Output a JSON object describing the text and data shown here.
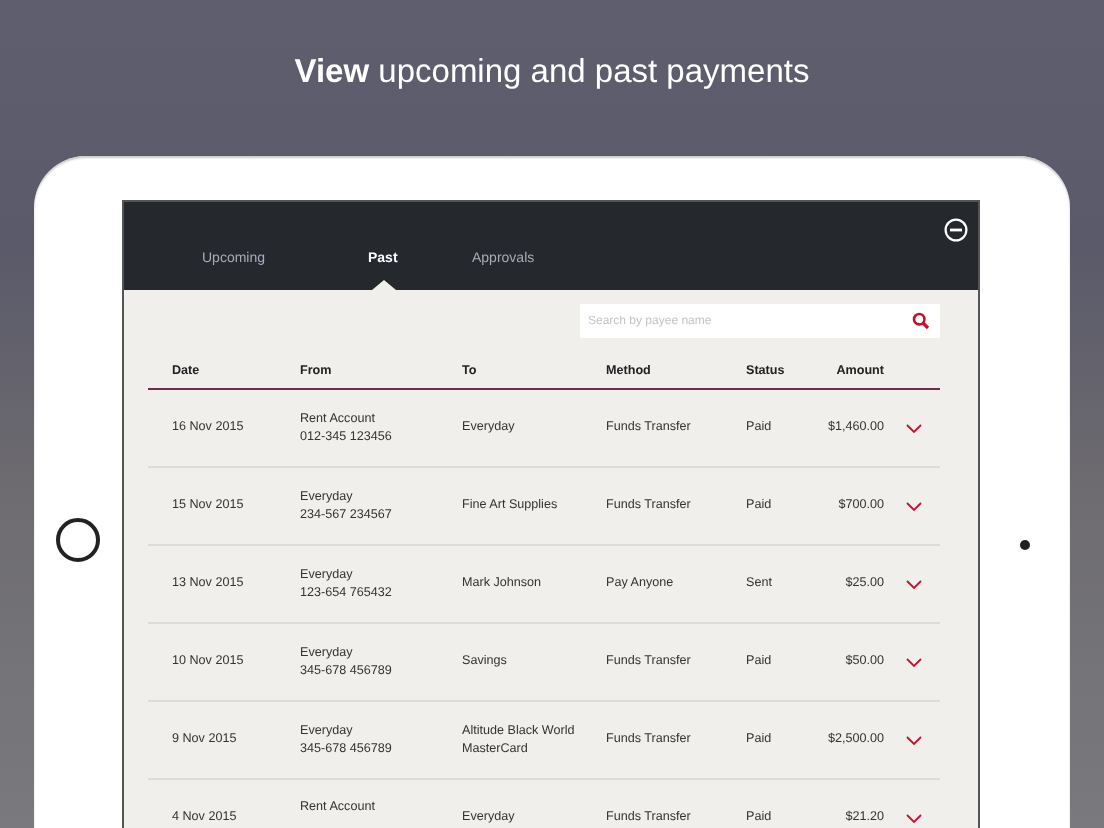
{
  "headline": "**View** upcoming and past payments",
  "tabs": [
    {
      "label": "Upcoming",
      "selected": false
    },
    {
      "label": "Past",
      "selected": true
    },
    {
      "label": "Approvals",
      "selected": false
    }
  ],
  "search": {
    "placeholder": "Search by payee name"
  },
  "table": {
    "columns": [
      "Date",
      "From",
      "To",
      "Method",
      "Status",
      "Amount"
    ],
    "rows": [
      {
        "date": "16 Nov 2015",
        "from": [
          "Rent Account",
          "012-345 123456"
        ],
        "to": [
          "Everyday"
        ],
        "method": "Funds Transfer",
        "status": "Paid",
        "amount": "$1,460.00"
      },
      {
        "date": "15 Nov 2015",
        "from": [
          "Everyday",
          "234-567 234567"
        ],
        "to": [
          "Fine Art Supplies"
        ],
        "method": "Funds Transfer",
        "status": "Paid",
        "amount": "$700.00"
      },
      {
        "date": "13 Nov 2015",
        "from": [
          "Everyday",
          "123-654 765432"
        ],
        "to": [
          "Mark Johnson"
        ],
        "method": "Pay Anyone",
        "status": "Sent",
        "amount": "$25.00"
      },
      {
        "date": "10 Nov 2015",
        "from": [
          "Everyday",
          "345-678 456789"
        ],
        "to": [
          "Savings"
        ],
        "method": "Funds Transfer",
        "status": "Paid",
        "amount": "$50.00"
      },
      {
        "date": "9 Nov 2015",
        "from": [
          "Everyday",
          "345-678 456789"
        ],
        "to": [
          "Altitude Black World",
          "MasterCard"
        ],
        "method": "Funds Transfer",
        "status": "Paid",
        "amount": "$2,500.00"
      },
      {
        "date": "4 Nov 2015",
        "from": [
          "Rent Account"
        ],
        "to": [
          "Everyday"
        ],
        "method": "Funds Transfer",
        "status": "Paid",
        "amount": "$21.20"
      }
    ]
  }
}
